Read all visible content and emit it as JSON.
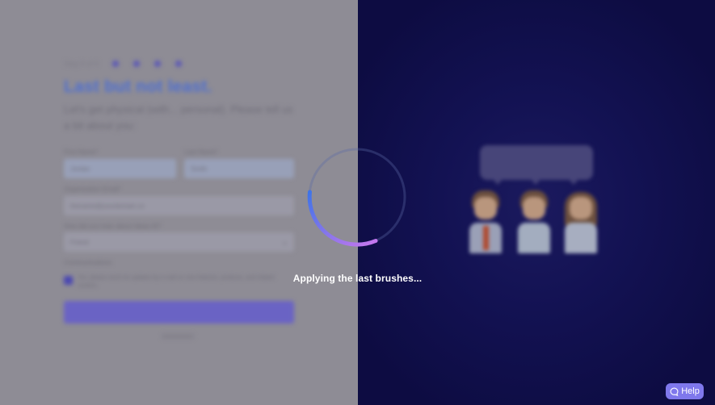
{
  "form": {
    "step_text": "Step 5 of 5",
    "title": "Last but not least.",
    "subtitle": "Let's get physical (with... personal). Please tell us a bit about you:",
    "first_name_label": "First Name*",
    "first_name_value": "Jordan",
    "last_name_label": "Last Name*",
    "last_name_value": "Smith",
    "email_label": "Organization Email*",
    "email_value": "thename@yourdomain.co",
    "source_label": "How did you hear about Ideas AI?",
    "source_value": "Friend",
    "consent_heading": "Communications",
    "consent_text": "Yes, please send me updates by e-mail on new features, products, and related content."
  },
  "overlay": {
    "loading_text": "Applying the last brushes..."
  },
  "help": {
    "label": "Help"
  },
  "colors": {
    "accent": "#7f78ec",
    "panel_dark": "#131253",
    "title_blue": "#4f6fd0"
  }
}
